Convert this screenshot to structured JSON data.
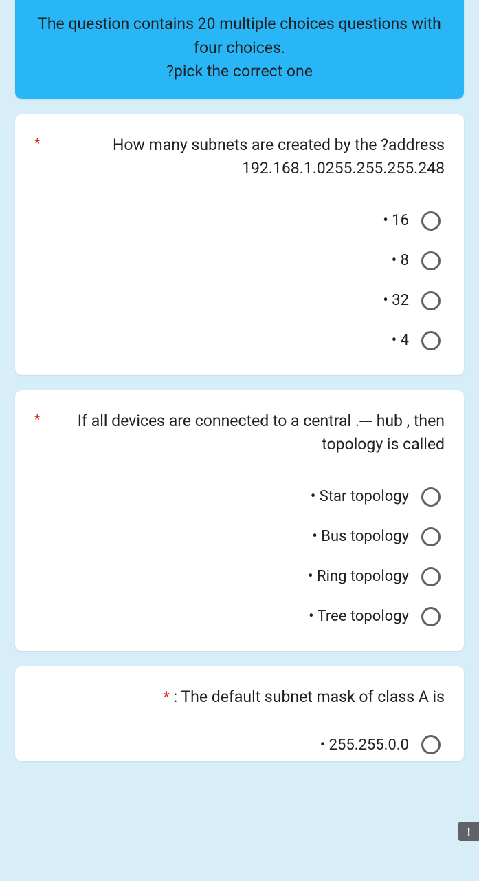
{
  "header": {
    "line1": "The question contains 20 multiple choices questions with four choices.",
    "line2": "?pick the correct one"
  },
  "required_mark": "*",
  "questions": [
    {
      "text": "How many subnets are created by the ?address 192.168.1.0255.255.255.248",
      "options": [
        "• 16",
        "• 8",
        "• 32",
        "• 4"
      ]
    },
    {
      "text": "If all devices are connected to a central .--- hub , then topology is called",
      "options": [
        "• Star topology",
        "• Bus topology",
        "• Ring topology",
        "• Tree topology"
      ]
    },
    {
      "text": " : The default subnet mask of class A is",
      "options": [
        "• 255.255.0.0"
      ]
    }
  ],
  "alert_icon": "!"
}
